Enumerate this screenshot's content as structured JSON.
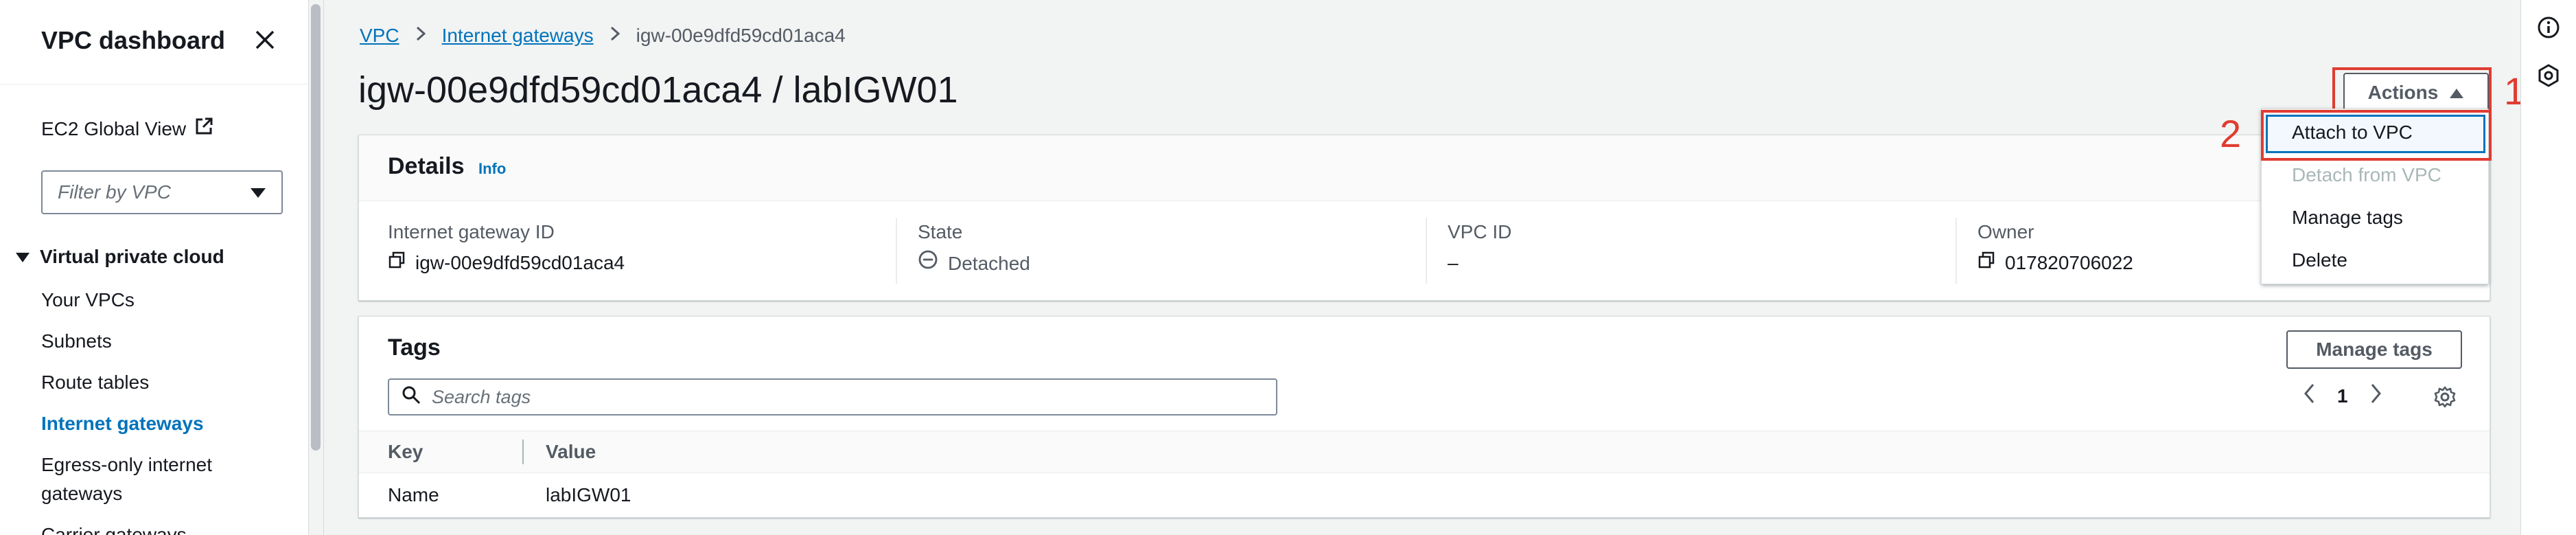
{
  "sidebar": {
    "title": "VPC dashboard",
    "ec2_link": "EC2 Global View",
    "filter_placeholder": "Filter by VPC",
    "section": "Virtual private cloud",
    "items": [
      {
        "label": "Your VPCs"
      },
      {
        "label": "Subnets"
      },
      {
        "label": "Route tables"
      },
      {
        "label": "Internet gateways",
        "active": true
      },
      {
        "label": "Egress-only internet"
      },
      {
        "label": "gateways"
      },
      {
        "label": "Carrier gateways"
      }
    ]
  },
  "breadcrumb": {
    "items": [
      "VPC",
      "Internet gateways"
    ],
    "current": "igw-00e9dfd59cd01aca4"
  },
  "page": {
    "title": "igw-00e9dfd59cd01aca4 / labIGW01",
    "actions_label": "Actions"
  },
  "details": {
    "title": "Details",
    "info": "Info",
    "fields": [
      {
        "label": "Internet gateway ID",
        "value": "igw-00e9dfd59cd01aca4"
      },
      {
        "label": "State",
        "value": "Detached"
      },
      {
        "label": "VPC ID",
        "value": "–"
      },
      {
        "label": "Owner",
        "value": "017820706022"
      }
    ]
  },
  "actions_menu": {
    "items": [
      {
        "label": "Attach to VPC",
        "enabled": true
      },
      {
        "label": "Detach from VPC",
        "enabled": false
      },
      {
        "label": "Manage tags",
        "enabled": true
      },
      {
        "label": "Delete",
        "enabled": true
      }
    ]
  },
  "annotations": {
    "step1": "1",
    "step2": "2",
    "color": "#e03c31"
  },
  "tags": {
    "title": "Tags",
    "manage_label": "Manage tags",
    "search_placeholder": "Search tags",
    "page": "1",
    "columns": [
      "Key",
      "Value"
    ],
    "rows": [
      {
        "key": "Name",
        "value": "labIGW01"
      }
    ]
  },
  "colors": {
    "link": "#0073bb",
    "text": "#16191f",
    "muted": "#545b64",
    "background": "#f2f3f3"
  }
}
